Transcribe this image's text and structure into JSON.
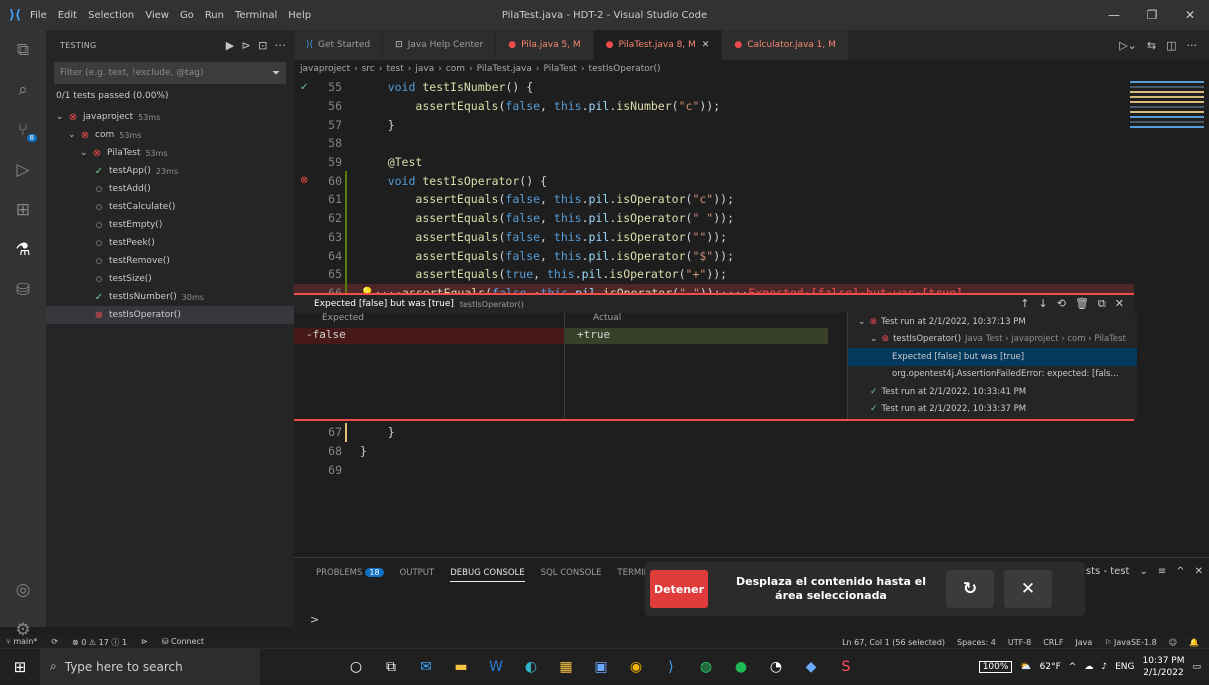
{
  "window": {
    "title": "PilaTest.java - HDT-2 - Visual Studio Code",
    "menu": [
      "File",
      "Edit",
      "Selection",
      "View",
      "Go",
      "Run",
      "Terminal",
      "Help"
    ]
  },
  "sidebar": {
    "title": "TESTING",
    "filter_placeholder": "Filter (e.g. text, !exclude, @tag)",
    "status": "0/1 tests passed (0.00%)",
    "tree": [
      {
        "label": "javaproject",
        "duration": "53ms",
        "state": "fail",
        "depth": 0,
        "expand": true
      },
      {
        "label": "com",
        "duration": "53ms",
        "state": "fail",
        "depth": 1,
        "expand": true
      },
      {
        "label": "PilaTest",
        "duration": "53ms",
        "state": "fail",
        "depth": 2,
        "expand": true
      },
      {
        "label": "testApp()",
        "duration": "23ms",
        "state": "pass",
        "depth": 3
      },
      {
        "label": "testAdd()",
        "duration": "",
        "state": "idle",
        "depth": 3
      },
      {
        "label": "testCalculate()",
        "duration": "",
        "state": "idle",
        "depth": 3
      },
      {
        "label": "testEmpty()",
        "duration": "",
        "state": "idle",
        "depth": 3
      },
      {
        "label": "testPeek()",
        "duration": "",
        "state": "idle",
        "depth": 3
      },
      {
        "label": "testRemove()",
        "duration": "",
        "state": "idle",
        "depth": 3
      },
      {
        "label": "testSize()",
        "duration": "",
        "state": "idle",
        "depth": 3
      },
      {
        "label": "testIsNumber()",
        "duration": "30ms",
        "state": "pass",
        "depth": 3
      },
      {
        "label": "testIsOperator()",
        "duration": "",
        "state": "fail",
        "depth": 3,
        "selected": true
      }
    ]
  },
  "tabs": [
    {
      "label": "Get Started",
      "icon": "vscode-icon",
      "kind": "normal"
    },
    {
      "label": "Java Help Center",
      "icon": "java-help-icon",
      "kind": "normal"
    },
    {
      "label": "Pila.java 5, M",
      "icon": "error-dot",
      "kind": "err"
    },
    {
      "label": "PilaTest.java 8, M",
      "icon": "error-dot",
      "kind": "err-active"
    },
    {
      "label": "Calculator.java 1, M",
      "icon": "error-dot",
      "kind": "err"
    }
  ],
  "breadcrumb": [
    "javaproject",
    "src",
    "test",
    "java",
    "com",
    "PilaTest.java",
    "PilaTest",
    "testIsOperator()"
  ],
  "code_top": [
    {
      "n": "55",
      "icon": "pass",
      "text": "    void testIsNumber() {"
    },
    {
      "n": "56",
      "icon": "",
      "text": "        assertEquals(false, this.pil.isNumber(\"c\"));"
    },
    {
      "n": "57",
      "icon": "",
      "text": "    }"
    },
    {
      "n": "58",
      "icon": "",
      "text": ""
    },
    {
      "n": "59",
      "icon": "",
      "text": "    @Test"
    },
    {
      "n": "60",
      "icon": "fail",
      "text": "    void testIsOperator() {"
    },
    {
      "n": "61",
      "icon": "",
      "text": "        assertEquals(false, this.pil.isOperator(\"c\"));"
    },
    {
      "n": "62",
      "icon": "",
      "text": "        assertEquals(false, this.pil.isOperator(\" \"));"
    },
    {
      "n": "63",
      "icon": "",
      "text": "        assertEquals(false, this.pil.isOperator(\"\"));"
    },
    {
      "n": "64",
      "icon": "",
      "text": "        assertEquals(false, this.pil.isOperator(\"$\"));"
    },
    {
      "n": "65",
      "icon": "",
      "text": "        assertEquals(true, this.pil.isOperator(\"+\"));"
    },
    {
      "n": "66",
      "icon": "",
      "text": "····assertEquals(false,·this.pil.isOperator(\"-\"));····",
      "error": "Expected·[false]·but·was·[true]"
    }
  ],
  "peek": {
    "title": "Expected [false] but was [true]",
    "subtitle": "testIsOperator()",
    "expected_label": "Expected",
    "actual_label": "Actual",
    "expected_value": "-false",
    "actual_value": "+true",
    "results": [
      {
        "text": "Test run at 2/1/2022, 10:37:13 PM",
        "state": "fail",
        "indent": 0,
        "chev": true
      },
      {
        "text": "testIsOperator()",
        "muted": "Java Test › javaproject › com › PilaTest",
        "state": "fail",
        "indent": 1,
        "chev": true
      },
      {
        "text": "Expected [false] but was [true]",
        "state": "",
        "indent": 2,
        "selected": true
      },
      {
        "text": "org.opentest4j.AssertionFailedError: expected: [fals...",
        "state": "",
        "indent": 2
      },
      {
        "text": "Test run at 2/1/2022, 10:33:41 PM",
        "state": "pass",
        "indent": 1
      },
      {
        "text": "Test run at 2/1/2022, 10:33:37 PM",
        "state": "pass",
        "indent": 1
      }
    ]
  },
  "code_bottom": [
    {
      "n": "67",
      "text": "    }"
    },
    {
      "n": "68",
      "text": "}"
    },
    {
      "n": "69",
      "text": ""
    }
  ],
  "panel": {
    "tabs": [
      "PROBLEMS",
      "OUTPUT",
      "DEBUG CONSOLE",
      "SQL CONSOLE",
      "TERMINA"
    ],
    "problems_count": "18",
    "right_label": "sts - test",
    "prompt": ">"
  },
  "overlay": {
    "stop": "Detener",
    "message": "Desplaza el contenido hasta el área seleccionada"
  },
  "statusbar": {
    "branch": "main*",
    "errors": "0",
    "warnings": "17",
    "info": "1",
    "connect": "Connect",
    "position": "Ln 67, Col 1 (56 selected)",
    "spaces": "Spaces: 4",
    "encoding": "UTF-8",
    "eol": "CRLF",
    "language": "Java",
    "jdk": "JavaSE-1.8"
  },
  "taskbar": {
    "search_placeholder": "Type here to search",
    "battery": "100%",
    "weather": "62°F",
    "lang": "ENG",
    "time": "10:37 PM",
    "date": "2/1/2022"
  }
}
